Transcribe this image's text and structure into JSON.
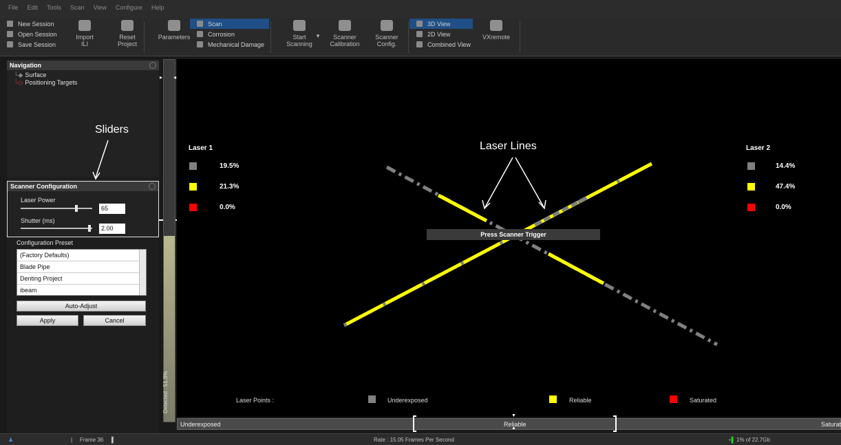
{
  "menu": [
    "File",
    "Edit",
    "Tools",
    "Scan",
    "View",
    "Configure",
    "Help"
  ],
  "ribbon": {
    "session": [
      "New Session",
      "Open Session",
      "Save Session"
    ],
    "import_ili": "Import ILI",
    "reset_project": "Reset Project",
    "parameters": "Parameters",
    "modes": [
      "Scan",
      "Corrosion",
      "Mechanical Damage"
    ],
    "start_scanning": "Start Scanning",
    "scanner_calibration": "Scanner Calibration",
    "scanner_config": "Scanner Config.",
    "views": [
      "3D View",
      "2D View",
      "Combined View"
    ],
    "vxremote": "VXremote"
  },
  "navigation": {
    "title": "Navigation",
    "items": [
      "Surface",
      "Positioning Targets"
    ]
  },
  "annotations": {
    "sliders": "Sliders",
    "laser_lines": "Laser Lines"
  },
  "scanner_config": {
    "title": "Scanner Configuration",
    "laser_power_label": "Laser Power",
    "laser_power_value": "65",
    "laser_power_level": 0.65,
    "shutter_label": "Shutter (ms)",
    "shutter_value": "2.00",
    "shutter_level": 0.96
  },
  "preset": {
    "label": "Configuration Preset",
    "items": [
      "(Factory Defaults)",
      "Blade Pipe",
      "Denting Project",
      "ibeam"
    ],
    "auto_adjust": "Auto-Adjust",
    "apply": "Apply",
    "cancel": "Cancel"
  },
  "gauge": {
    "label": "Detected : 51.3%",
    "level": 0.513
  },
  "laser1": {
    "title": "Laser 1",
    "values": [
      "19.5%",
      "21.3%",
      "0.0%"
    ]
  },
  "laser2": {
    "title": "Laser 2",
    "values": [
      "14.4%",
      "47.4%",
      "0.0%"
    ]
  },
  "colors": {
    "underexposed": "#808080",
    "reliable": "#ffff00",
    "saturated": "#ff0000"
  },
  "trigger_text": "Press Scanner Trigger",
  "bottom_legend": {
    "laser_points": "Laser Points :",
    "underexposed": "Underexposed",
    "reliable": "Reliable",
    "saturated": "Saturated"
  },
  "exposure_bar": {
    "left": "Underexposed",
    "center": "Reliable",
    "right": "Saturated"
  },
  "status": {
    "frame": "Frame 36",
    "rate": "Rate : 15.05 Frames Per Second",
    "disk": "1% of 22.7Gb"
  }
}
